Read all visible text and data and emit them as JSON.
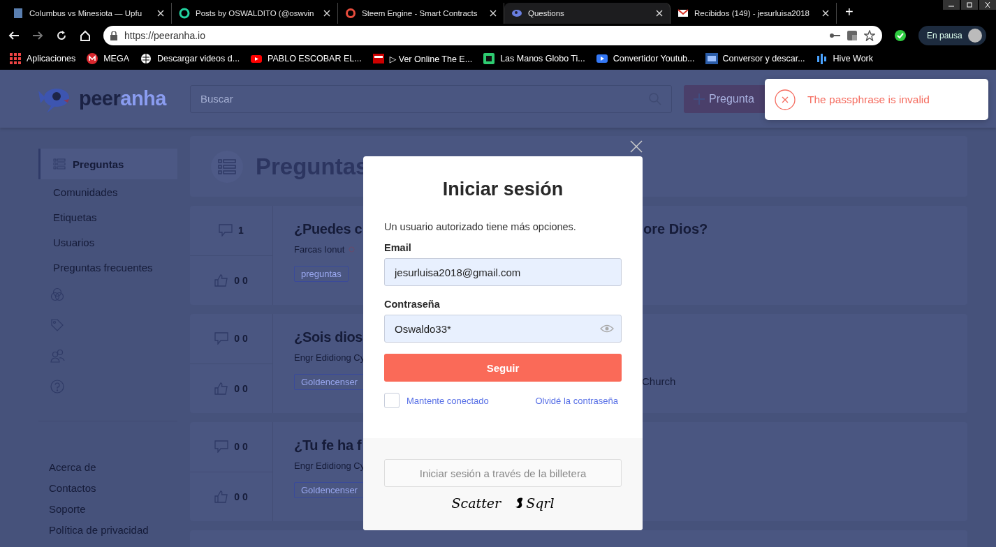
{
  "browser": {
    "tabs": [
      {
        "title": "Columbus vs Minesiota — Upfu",
        "kind": "doc",
        "selected": false
      },
      {
        "title": "Posts by OSWALDITO (@oswvin",
        "kind": "ring",
        "selected": false
      },
      {
        "title": "Steem Engine - Smart Contracts",
        "kind": "coin",
        "selected": false
      },
      {
        "title": "Questions",
        "kind": "fish",
        "selected": true
      },
      {
        "title": "Recibidos (149) - jesurluisa2018",
        "kind": "mail",
        "selected": false
      }
    ],
    "new_tab": "+",
    "url": "https://peeranha.io",
    "profile": "En pausa",
    "bookmarks": [
      {
        "label": "Aplicaciones",
        "kind": "apps"
      },
      {
        "label": "MEGA",
        "kind": "mega"
      },
      {
        "label": "Descargar videos d...",
        "kind": "globe"
      },
      {
        "label": "PABLO ESCOBAR EL...",
        "kind": "video"
      },
      {
        "label": "▷ Ver Online The E...",
        "kind": "tv"
      },
      {
        "label": "Las Manos Globo Ti...",
        "kind": "square"
      },
      {
        "label": "Convertidor Youtub...",
        "kind": "play"
      },
      {
        "label": "Conversor y descar...",
        "kind": "screen"
      },
      {
        "label": "Hive Work",
        "kind": "bars"
      }
    ]
  },
  "header": {
    "logo": {
      "dark": "peer",
      "light": "anha"
    },
    "search": {
      "placeholder": "Buscar"
    },
    "ask_button": "Pregunta"
  },
  "sidebar": {
    "items": [
      {
        "label": "Preguntas",
        "selected": true
      },
      {
        "label": "Comunidades",
        "selected": false
      },
      {
        "label": "Etiquetas",
        "selected": false
      },
      {
        "label": "Usuarios",
        "selected": false
      },
      {
        "label": "Preguntas frecuentes",
        "selected": false
      }
    ],
    "icon_items": [
      {
        "kind": "communities"
      },
      {
        "kind": "tags"
      },
      {
        "kind": "users"
      },
      {
        "kind": "faq"
      }
    ],
    "footer_links": [
      "Acerca de",
      "Contactos",
      "Soporte",
      "Política de privacidad"
    ]
  },
  "page_title": "Preguntas",
  "questions": [
    {
      "answers": "1",
      "likes": "0 0",
      "title_start": "¿Puedes c",
      "title_end": "ore Dios?",
      "author": "Farcas Ionut",
      "tags": [
        "preguntas"
      ]
    },
    {
      "answers": "0 0",
      "likes": "0 0",
      "title_start": "¿Sois dios",
      "author": "Engr Edidiong Cy",
      "tags": [
        "Goldencenser"
      ],
      "tail": "Church"
    },
    {
      "answers": "0 0",
      "likes": "0 0",
      "title_start": "¿Tu fe ha f",
      "author": "Engr Edidiong Cy",
      "tags": [
        "Goldencenser"
      ]
    }
  ],
  "login": {
    "title": "Iniciar sesión",
    "description": "Un usuario autorizado tiene más opciones.",
    "email": {
      "label": "Email",
      "value": "jesurluisa2018@gmail.com"
    },
    "password": {
      "label": "Contraseña",
      "value": "Oswaldo33*"
    },
    "submit": "Seguir",
    "remember": {
      "label": "Mantente conectado",
      "checked": false
    },
    "forgot": "Olvidé la contraseña",
    "wallet_button": "Iniciar sesión a través de la billetera",
    "wallets": [
      "Scatter",
      "Sqrl"
    ]
  },
  "toast": {
    "message": "The passphrase is invalid"
  }
}
